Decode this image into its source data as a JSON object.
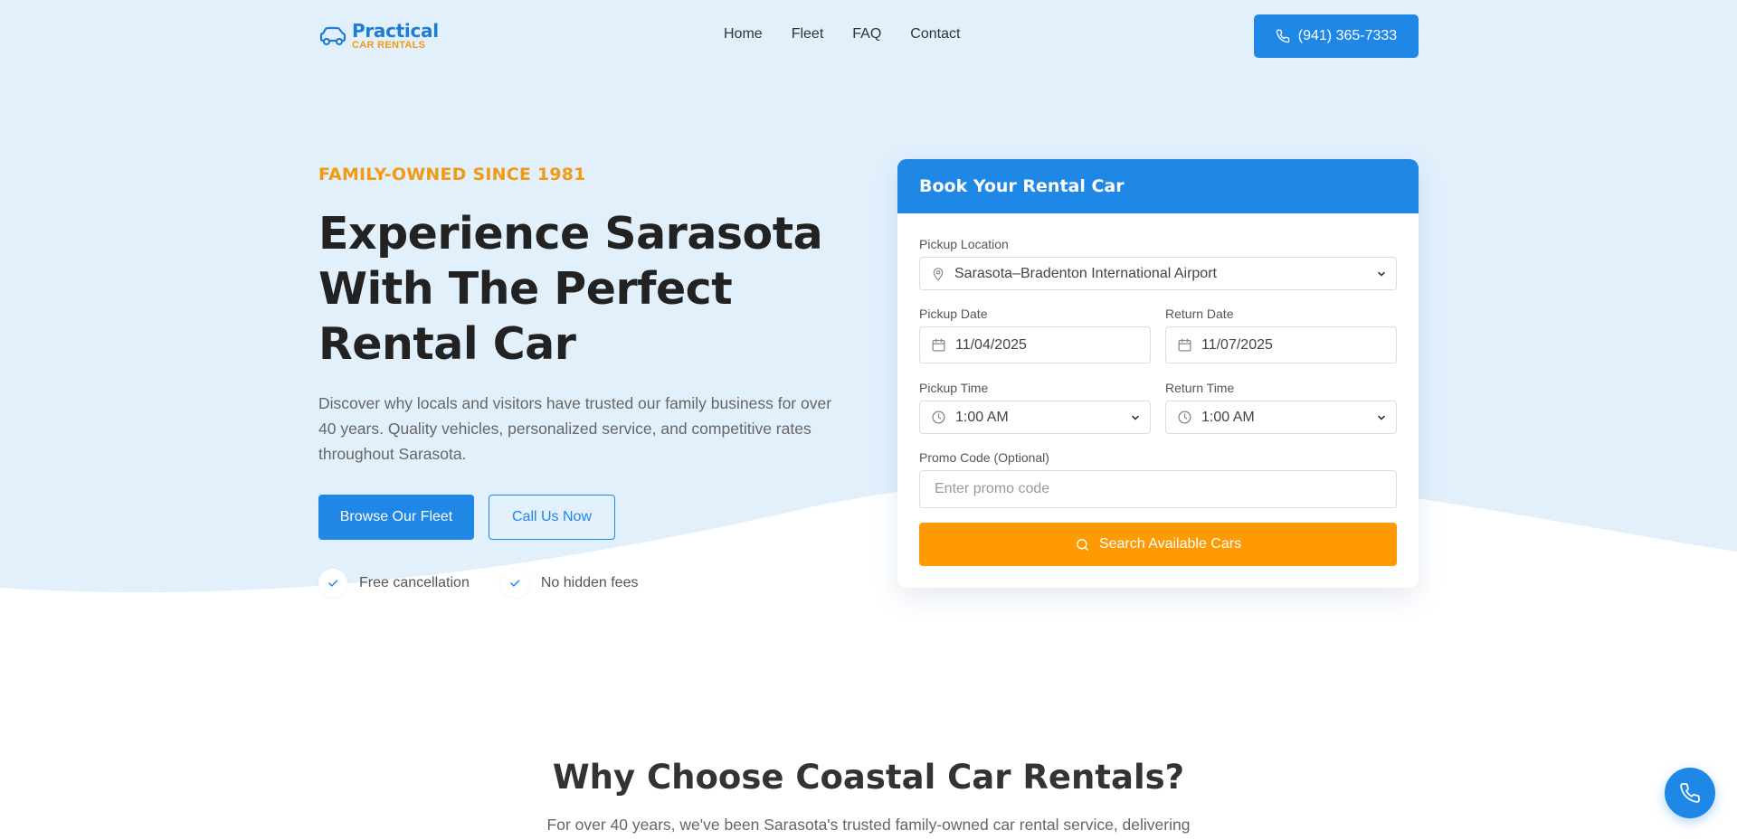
{
  "brand": {
    "name": "Practical",
    "tagline": "CAR RENTALS",
    "icon": "car-icon"
  },
  "nav": {
    "links": [
      "Home",
      "Fleet",
      "FAQ",
      "Contact"
    ],
    "phone": "(941) 365-7333"
  },
  "hero": {
    "eyebrow": "FAMILY-OWNED SINCE 1981",
    "headline": "Experience Sarasota With The Perfect Rental Car",
    "subtext": "Discover why locals and visitors have trusted our family business for over 40 years. Quality vehicles, personalized service, and competitive rates throughout Sarasota.",
    "primary_cta": "Browse Our Fleet",
    "secondary_cta": "Call Us Now",
    "features": [
      "Free cancellation",
      "No hidden fees"
    ]
  },
  "booking": {
    "title": "Book Your Rental Car",
    "pickup_location_label": "Pickup Location",
    "pickup_location_value": "Sarasota–Bradenton International Airport",
    "pickup_date_label": "Pickup Date",
    "pickup_date_value": "11/04/2025",
    "return_date_label": "Return Date",
    "return_date_value": "11/07/2025",
    "pickup_time_label": "Pickup Time",
    "pickup_time_value": "1:00 AM",
    "return_time_label": "Return Time",
    "return_time_value": "1:00 AM",
    "promo_label": "Promo Code (Optional)",
    "promo_placeholder": "Enter promo code",
    "search_label": "Search Available Cars"
  },
  "why": {
    "title": "Why Choose Coastal Car Rentals?",
    "subtitle": "For over 40 years, we've been Sarasota's trusted family-owned car rental service, delivering"
  },
  "colors": {
    "primary": "#1f87e5",
    "accent": "#f39a12",
    "cta": "#ff9a05",
    "hero_bg": "#e2f0fc"
  }
}
